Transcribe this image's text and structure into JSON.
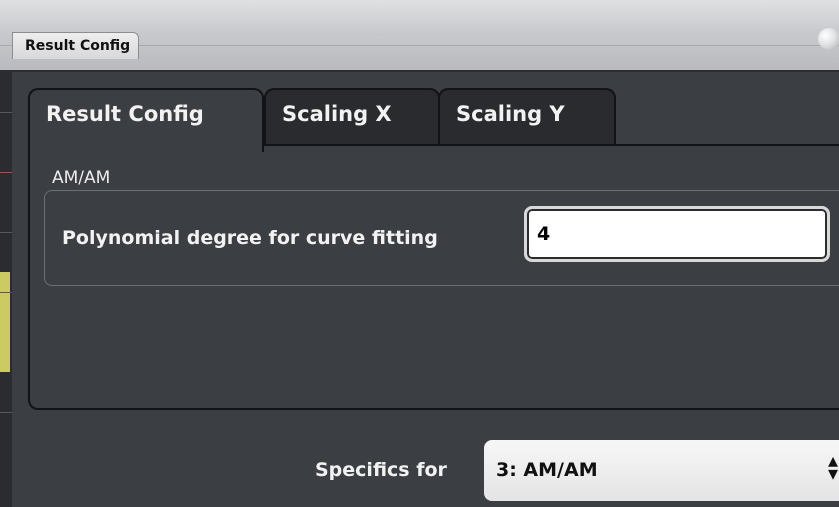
{
  "window": {
    "title": "Result Config"
  },
  "tabs": [
    {
      "label": "Result Config",
      "active": true
    },
    {
      "label": "Scaling X",
      "active": false
    },
    {
      "label": "Scaling Y",
      "active": false
    }
  ],
  "group": {
    "title": "AM/AM",
    "field_label": "Polynomial degree for curve fitting",
    "field_value": "4"
  },
  "specifics": {
    "label": "Specifics for",
    "value": "3: AM/AM"
  },
  "colors": {
    "background": "#3b3e42",
    "titlebar": "#c9cacd",
    "input_background": "#ffffff"
  }
}
